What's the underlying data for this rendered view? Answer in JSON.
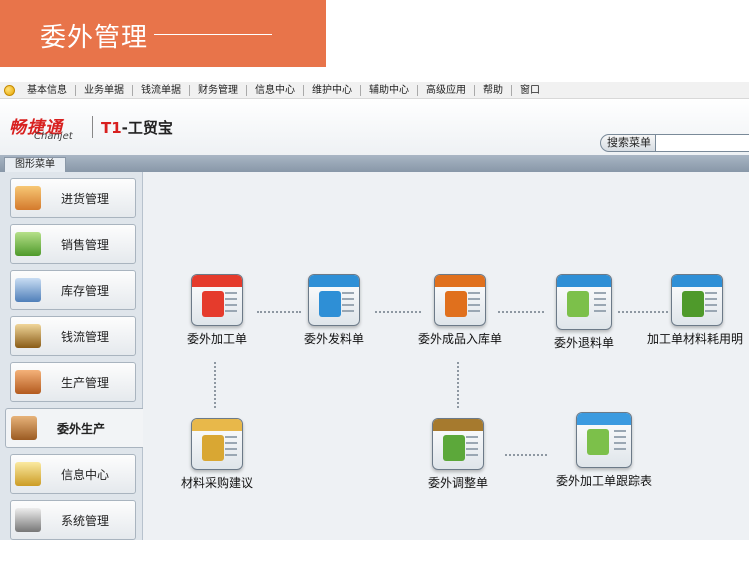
{
  "banner": {
    "title": "委外管理"
  },
  "menubar": {
    "items": [
      "基本信息",
      "业务单据",
      "钱流单据",
      "财务管理",
      "信息中心",
      "维护中心",
      "辅助中心",
      "高级应用",
      "帮助",
      "窗口"
    ]
  },
  "brand": {
    "cn": "畅捷通",
    "en": "Chanjet",
    "product_t1": "T1",
    "product_rest": "-工贸宝"
  },
  "search": {
    "label": "搜索菜单",
    "value": ""
  },
  "tabs": {
    "graphic_menu": "图形菜单"
  },
  "sidebar": {
    "items": [
      {
        "label": "进货管理",
        "icon": "purchase-icon"
      },
      {
        "label": "销售管理",
        "icon": "sales-basket-icon"
      },
      {
        "label": "库存管理",
        "icon": "inventory-icon"
      },
      {
        "label": "钱流管理",
        "icon": "cash-flow-icon"
      },
      {
        "label": "生产管理",
        "icon": "production-icon"
      },
      {
        "label": "委外生产",
        "icon": "outsource-production-icon",
        "active": true
      },
      {
        "label": "信息中心",
        "icon": "info-center-icon"
      },
      {
        "label": "系统管理",
        "icon": "system-settings-icon"
      }
    ]
  },
  "workflow": {
    "nodes": [
      {
        "label": "委外加工单",
        "icon": "outsource-order-icon",
        "color": "#e53b2c"
      },
      {
        "label": "委外发料单",
        "icon": "outsource-issue-icon",
        "color": "#2e8fd6"
      },
      {
        "label": "委外成品入库单",
        "icon": "outsource-receipt-icon",
        "color": "#e0701d"
      },
      {
        "label": "委外退料单",
        "icon": "outsource-return-icon",
        "color": "#2e8fd6"
      },
      {
        "label": "加工单材料耗用明",
        "icon": "material-consumption-icon",
        "color": "#2e8fd6"
      },
      {
        "label": "材料采购建议",
        "icon": "purchase-suggestion-icon",
        "color": "#e8b84a"
      },
      {
        "label": "委外调整单",
        "icon": "outsource-adjust-icon",
        "color": "#a67a2e"
      },
      {
        "label": "委外加工单跟踪表",
        "icon": "order-tracking-icon",
        "color": "#3c9be0"
      }
    ]
  }
}
